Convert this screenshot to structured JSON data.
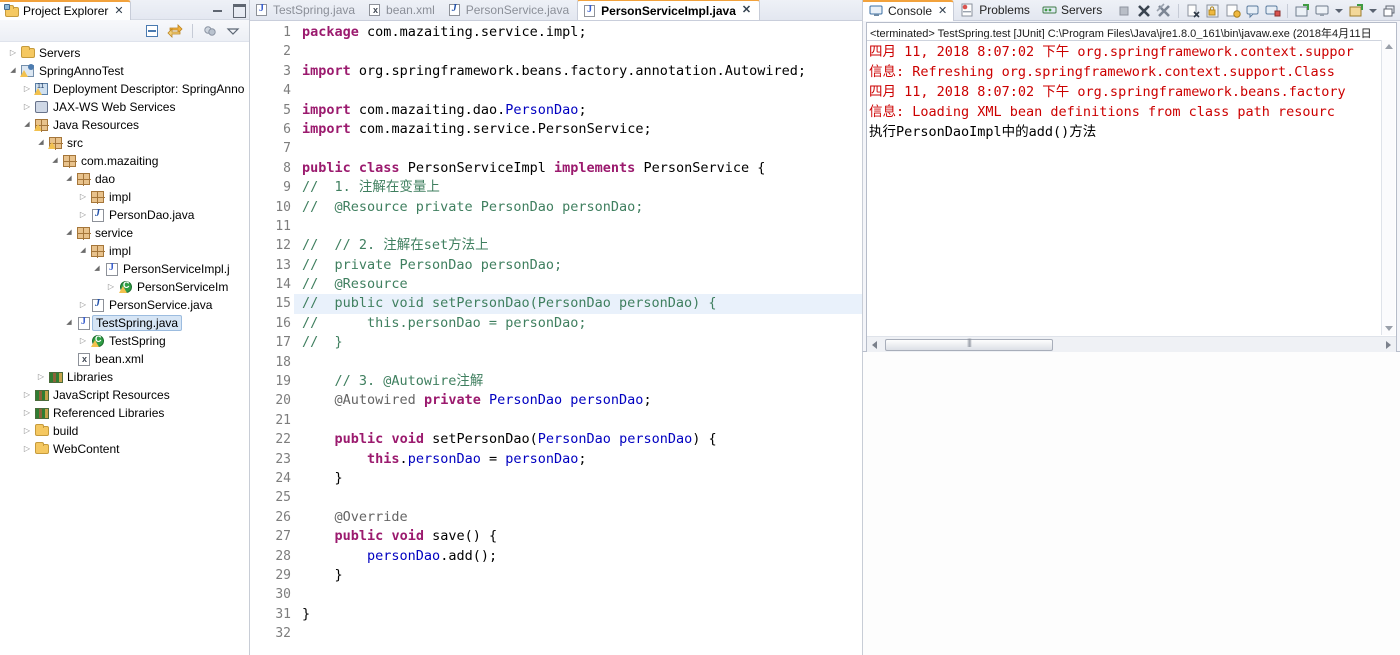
{
  "explorer": {
    "tab_label": "Project Explorer",
    "tab_close": "✕",
    "toolbar": [
      {
        "name": "collapse-all-icon",
        "title": "Collapse All"
      },
      {
        "name": "link-with-editor-icon",
        "title": "Link with Editor"
      },
      {
        "name": "view-menu-filter-icon",
        "title": "Filters"
      },
      {
        "name": "view-menu-icon",
        "title": "View Menu"
      }
    ],
    "tree": [
      {
        "label": "Servers",
        "indent": 0,
        "twisty": "collapsed",
        "icon": "folder-icon"
      },
      {
        "label": "SpringAnnoTest",
        "indent": 0,
        "twisty": "expanded",
        "icon": "project-icon"
      },
      {
        "label": "Deployment Descriptor: SpringAnno",
        "indent": 1,
        "twisty": "collapsed",
        "icon": "deployment-descriptor-icon"
      },
      {
        "label": "JAX-WS Web Services",
        "indent": 1,
        "twisty": "collapsed",
        "icon": "web-service-icon"
      },
      {
        "label": "Java Resources",
        "indent": 1,
        "twisty": "expanded",
        "icon": "java-resources-icon"
      },
      {
        "label": "src",
        "indent": 2,
        "twisty": "expanded",
        "icon": "source-folder-icon"
      },
      {
        "label": "com.mazaiting",
        "indent": 3,
        "twisty": "expanded",
        "icon": "package-icon"
      },
      {
        "label": "dao",
        "indent": 4,
        "twisty": "expanded",
        "icon": "package-icon"
      },
      {
        "label": "impl",
        "indent": 5,
        "twisty": "collapsed",
        "icon": "package-icon"
      },
      {
        "label": "PersonDao.java",
        "indent": 5,
        "twisty": "collapsed",
        "icon": "java-interface-icon"
      },
      {
        "label": "service",
        "indent": 4,
        "twisty": "expanded",
        "icon": "package-icon"
      },
      {
        "label": "impl",
        "indent": 5,
        "twisty": "expanded",
        "icon": "package-icon"
      },
      {
        "label": "PersonServiceImpl.j",
        "indent": 6,
        "twisty": "expanded",
        "icon": "java-file-icon"
      },
      {
        "label": "PersonServiceIm",
        "indent": 7,
        "twisty": "collapsed",
        "icon": "class-icon"
      },
      {
        "label": "PersonService.java",
        "indent": 5,
        "twisty": "collapsed",
        "icon": "java-interface-icon"
      },
      {
        "label": "TestSpring.java",
        "indent": 4,
        "twisty": "expanded",
        "icon": "java-file-icon",
        "selected": true
      },
      {
        "label": "TestSpring",
        "indent": 5,
        "twisty": "collapsed",
        "icon": "class-icon"
      },
      {
        "label": "bean.xml",
        "indent": 4,
        "twisty": "none",
        "icon": "xml-file-icon"
      },
      {
        "label": "Libraries",
        "indent": 2,
        "twisty": "collapsed",
        "icon": "library-icon"
      },
      {
        "label": "JavaScript Resources",
        "indent": 1,
        "twisty": "collapsed",
        "icon": "library-icon"
      },
      {
        "label": "Referenced Libraries",
        "indent": 1,
        "twisty": "collapsed",
        "icon": "library-icon"
      },
      {
        "label": "build",
        "indent": 1,
        "twisty": "collapsed",
        "icon": "folder-icon"
      },
      {
        "label": "WebContent",
        "indent": 1,
        "twisty": "collapsed",
        "icon": "folder-icon"
      }
    ]
  },
  "editor": {
    "tabs": [
      {
        "label": "TestSpring.java",
        "icon": "java-file-icon",
        "active": false
      },
      {
        "label": "bean.xml",
        "icon": "xml-file-icon",
        "active": false
      },
      {
        "label": "PersonService.java",
        "icon": "java-interface-icon",
        "active": false
      },
      {
        "label": "PersonServiceImpl.java",
        "icon": "java-file-icon",
        "active": true,
        "close": "✕"
      }
    ],
    "change_bar_color": "#5fb0ec",
    "highlight_line": 15,
    "lines": [
      {
        "n": 1,
        "fold": "",
        "marker": "",
        "text": "package com.mazaiting.service.impl;"
      },
      {
        "n": 2,
        "fold": "",
        "marker": "",
        "text": ""
      },
      {
        "n": 3,
        "fold": "minus",
        "marker": "",
        "text": "import org.springframework.beans.factory.annotation.Autowired;"
      },
      {
        "n": 4,
        "fold": "",
        "marker": "",
        "text": ""
      },
      {
        "n": 5,
        "fold": "",
        "marker": "",
        "text": "import com.mazaiting.dao.PersonDao;"
      },
      {
        "n": 6,
        "fold": "",
        "marker": "",
        "text": "import com.mazaiting.service.PersonService;"
      },
      {
        "n": 7,
        "fold": "",
        "marker": "",
        "text": ""
      },
      {
        "n": 8,
        "fold": "",
        "marker": "",
        "text": "public class PersonServiceImpl implements PersonService {"
      },
      {
        "n": 9,
        "fold": "",
        "marker": "",
        "text": "//  1. 注解在变量上"
      },
      {
        "n": 10,
        "fold": "",
        "marker": "",
        "text": "//  @Resource private PersonDao personDao;"
      },
      {
        "n": 11,
        "fold": "",
        "marker": "",
        "text": ""
      },
      {
        "n": 12,
        "fold": "",
        "marker": "",
        "text": "//  // 2. 注解在set方法上"
      },
      {
        "n": 13,
        "fold": "",
        "marker": "",
        "text": "//  private PersonDao personDao;"
      },
      {
        "n": 14,
        "fold": "",
        "marker": "",
        "text": "//  @Resource"
      },
      {
        "n": 15,
        "fold": "",
        "marker": "",
        "text": "//  public void setPersonDao(PersonDao personDao) {"
      },
      {
        "n": 16,
        "fold": "",
        "marker": "",
        "text": "//      this.personDao = personDao;"
      },
      {
        "n": 17,
        "fold": "",
        "marker": "",
        "text": "//  }"
      },
      {
        "n": 18,
        "fold": "",
        "marker": "",
        "text": ""
      },
      {
        "n": 19,
        "fold": "",
        "marker": "",
        "text": "    // 3. @Autowire注解"
      },
      {
        "n": 20,
        "fold": "",
        "marker": "",
        "text": "    @Autowired private PersonDao personDao;"
      },
      {
        "n": 21,
        "fold": "",
        "marker": "",
        "text": ""
      },
      {
        "n": 22,
        "fold": "minus",
        "marker": "",
        "text": "    public void setPersonDao(PersonDao personDao) {"
      },
      {
        "n": 23,
        "fold": "",
        "marker": "",
        "text": "        this.personDao = personDao;"
      },
      {
        "n": 24,
        "fold": "",
        "marker": "",
        "text": "    }"
      },
      {
        "n": 25,
        "fold": "",
        "marker": "",
        "text": ""
      },
      {
        "n": 26,
        "fold": "minus",
        "marker": "",
        "text": "    @Override"
      },
      {
        "n": 27,
        "fold": "",
        "marker": "override",
        "text": "    public void save() {"
      },
      {
        "n": 28,
        "fold": "",
        "marker": "",
        "text": "        personDao.add();"
      },
      {
        "n": 29,
        "fold": "",
        "marker": "",
        "text": "    }"
      },
      {
        "n": 30,
        "fold": "",
        "marker": "",
        "text": ""
      },
      {
        "n": 31,
        "fold": "",
        "marker": "",
        "text": "}"
      },
      {
        "n": 32,
        "fold": "",
        "marker": "",
        "text": ""
      }
    ]
  },
  "console": {
    "tabs": [
      {
        "label": "Console",
        "icon": "console-icon",
        "active": true,
        "close": "✕"
      },
      {
        "label": "Problems",
        "icon": "problems-icon",
        "active": false
      },
      {
        "label": "Servers",
        "icon": "servers-icon",
        "active": false
      }
    ],
    "toolbar": [
      {
        "name": "terminate-icon",
        "title": "Terminate"
      },
      {
        "name": "remove-launch-icon",
        "title": "Remove Launch"
      },
      {
        "name": "remove-all-terminated-icon",
        "title": "Remove All Terminated Launches"
      },
      {
        "name": "clear-console-icon",
        "title": "Clear Console"
      },
      {
        "name": "scroll-lock-icon",
        "title": "Scroll Lock"
      },
      {
        "name": "pin-console-icon",
        "title": "Pin Console"
      },
      {
        "name": "display-selected-console-icon",
        "title": "Display Selected Console"
      },
      {
        "name": "open-console-icon",
        "title": "Open Console"
      },
      {
        "name": "new-console-view-icon",
        "title": "New Console View"
      },
      {
        "name": "minimize-icon",
        "title": "Minimize"
      },
      {
        "name": "maximize-icon",
        "title": "Maximize"
      }
    ],
    "header": "<terminated> TestSpring.test [JUnit] C:\\Program Files\\Java\\jre1.8.0_161\\bin\\javaw.exe (2018年4月11日",
    "lines": [
      {
        "text": "四月 11, 2018 8:07:02 下午 org.springframework.context.suppor",
        "color": "#cc0000"
      },
      {
        "text": "信息: Refreshing org.springframework.context.support.Class",
        "color": "#cc0000"
      },
      {
        "text": "四月 11, 2018 8:07:02 下午 org.springframework.beans.factory",
        "color": "#cc0000"
      },
      {
        "text": "信息: Loading XML bean definitions from class path resourc",
        "color": "#cc0000"
      },
      {
        "text": "执行PersonDaoImpl中的add()方法",
        "color": "#000000"
      }
    ]
  },
  "colors": {
    "accent_tab": "#f2a23c",
    "selection": "#d6e5f5",
    "change_bar": "#5fb0ec",
    "console_error": "#cc0000",
    "keyword": "#9b1a6e",
    "comment": "#3f7f5f",
    "field": "#0000c0",
    "annotation": "#646464"
  }
}
